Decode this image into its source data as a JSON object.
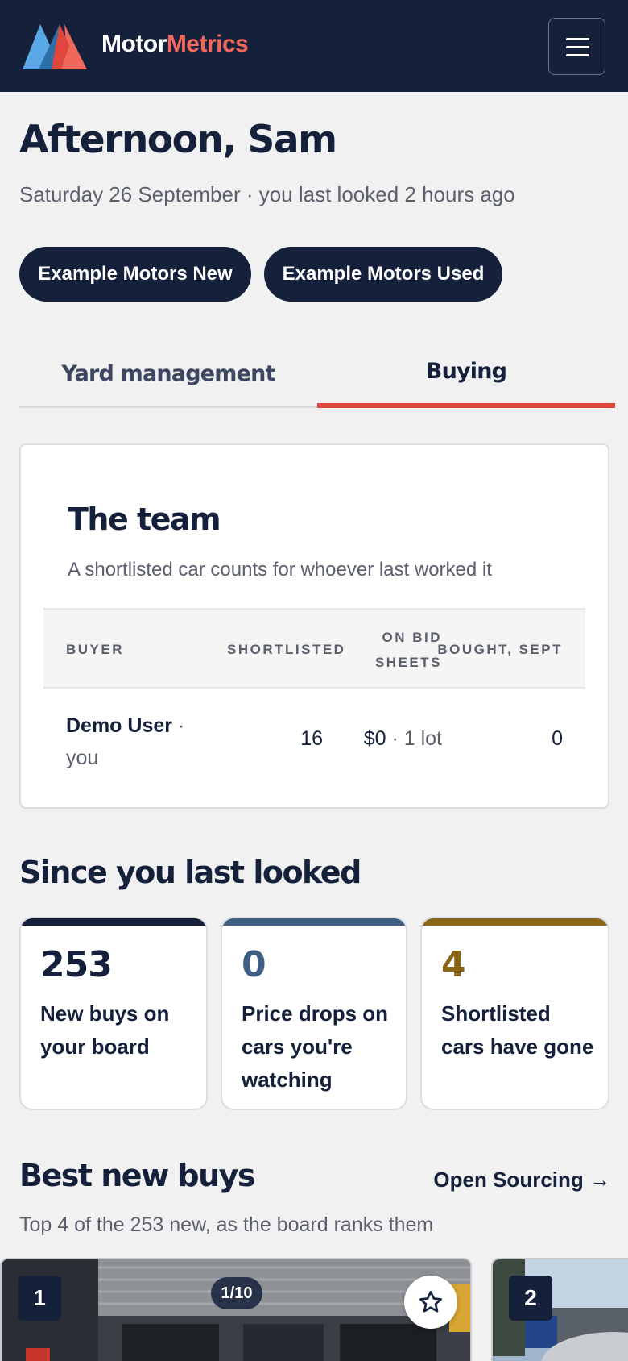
{
  "header": {
    "brand_part1": "Motor",
    "brand_part2": "Metrics",
    "logo_icon": "motormetrics-logo",
    "menu_icon": "hamburger-menu-icon",
    "colors": {
      "background": "#15203b",
      "brand_accent": "#f0675c",
      "logo_blue": "#5aa9e6"
    }
  },
  "greeting": {
    "title": "Afternoon, Sam",
    "subtitle": "Saturday 26 September · you last looked 2 hours ago"
  },
  "dealers": [
    "Example Motors New",
    "Example Motors Used"
  ],
  "tabs": [
    {
      "label": "Yard management",
      "active": false
    },
    {
      "label": "Buying",
      "active": true
    }
  ],
  "team": {
    "title": "The team",
    "subtitle": "A shortlisted car counts for whoever last worked it",
    "columns": [
      "BUYER",
      "SHORTLISTED",
      "ON BID",
      "SHEETS",
      "BOUGHT, SEPT"
    ],
    "rows": [
      {
        "name": "Demo User",
        "sep": " ·",
        "you": "you",
        "shortlisted": "16",
        "bid_amount": "$0",
        "bid_lots": " · 1 lot",
        "bought": "0"
      }
    ]
  },
  "since": {
    "title": "Since you last looked",
    "stats": [
      {
        "value": "253",
        "line1": "New buys on",
        "line2": "your board",
        "line3": "",
        "color": "#15203b"
      },
      {
        "value": "0",
        "line1": "Price drops on",
        "line2": "cars you're",
        "line3": "watching",
        "color": "#3f5f82"
      },
      {
        "value": "4",
        "line1": "Shortlisted",
        "line2": "cars have gone",
        "line3": "",
        "color": "#8a6516"
      }
    ]
  },
  "best": {
    "title": "Best new buys",
    "link": "Open Sourcing →",
    "subtitle": "Top 4 of the 253 new, as the board ranks them",
    "cards": [
      {
        "rank": "1",
        "photo_count": "1/10",
        "star_icon": "star-outline-icon"
      },
      {
        "rank": "2"
      }
    ]
  }
}
